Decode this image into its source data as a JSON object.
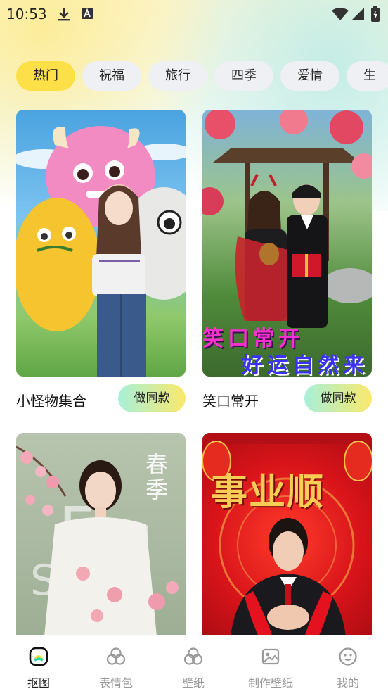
{
  "status_bar": {
    "time": "10:53"
  },
  "tabs": [
    {
      "label": "热门",
      "active": true
    },
    {
      "label": "祝福",
      "active": false
    },
    {
      "label": "旅行",
      "active": false
    },
    {
      "label": "四季",
      "active": false
    },
    {
      "label": "爱情",
      "active": false
    },
    {
      "label": "生",
      "active": false
    }
  ],
  "cards": [
    {
      "title": "小怪物集合",
      "button": "做同款"
    },
    {
      "title": "笑口常开",
      "button": "做同款",
      "overlay_line1": "笑口常开",
      "overlay_line2": "好运自然来"
    },
    {
      "title": "",
      "overlay_text": "春季"
    },
    {
      "title": "",
      "overlay_text": "事业顺"
    }
  ],
  "bottom_nav": [
    {
      "label": "抠图",
      "icon": "cutout-icon",
      "active": true
    },
    {
      "label": "表情包",
      "icon": "sticker-icon",
      "active": false
    },
    {
      "label": "壁纸",
      "icon": "wallpaper-icon",
      "active": false
    },
    {
      "label": "制作壁纸",
      "icon": "image-icon",
      "active": false
    },
    {
      "label": "我的",
      "icon": "profile-icon",
      "active": false
    }
  ],
  "colors": {
    "active_tab": "#fde047",
    "button_gradient_start": "#a7f0d9",
    "button_gradient_end": "#fbe86b"
  }
}
